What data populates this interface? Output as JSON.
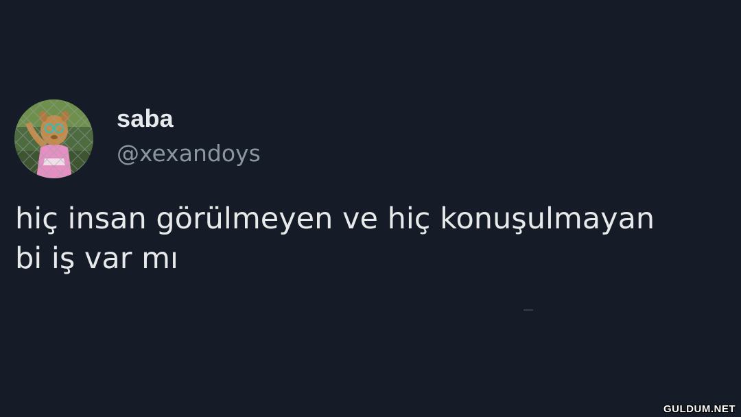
{
  "tweet": {
    "display_name": "saba",
    "handle": "@xexandoys",
    "text": "hiç insan görülmeyen ve hiç konuşulmayan\nbi iş var mı"
  },
  "avatar": {
    "icon": "cartoon-character-avatar"
  },
  "watermark": {
    "text": "GULDUM.NET"
  },
  "colors": {
    "background": "#151c27",
    "primary_text": "#e7e9ea",
    "secondary_text": "#8a97a3"
  }
}
